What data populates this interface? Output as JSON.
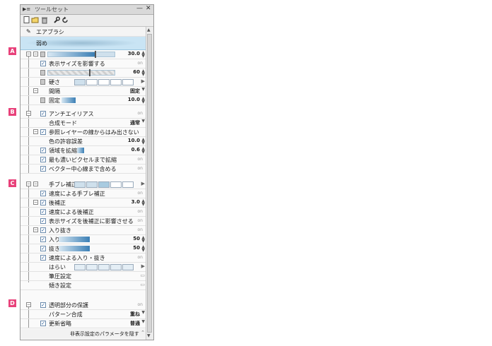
{
  "markers": [
    "A",
    "B",
    "C",
    "D"
  ],
  "titlebar": {
    "tab_label": "ツールセット",
    "minimize": "—",
    "close": "✕"
  },
  "toolbar_icons": [
    "new-sub-tool-icon",
    "folder-icon",
    "trash-icon",
    "wrench-icon",
    "reset-icon"
  ],
  "header": {
    "tool_name": "エアブラシ",
    "subtool": "弱め"
  },
  "rows": {
    "brush_size": {
      "value": "30.0",
      "fill_percent": 70
    },
    "size_pressure": {
      "label": "表示サイズを影響する",
      "state": "on"
    },
    "density": {
      "value": "60",
      "fill_percent": 60
    },
    "hardness": {
      "label": "硬さ",
      "cells": 5
    },
    "spacing": {
      "label": "間隔",
      "value": "固定"
    },
    "fixed": {
      "label": "固定",
      "value": "10.0",
      "fill_percent": 20
    },
    "antialias": {
      "label": "アンチエイリアス",
      "state": "on"
    },
    "blend_mode": {
      "label": "合成モード",
      "value": "通常"
    },
    "ref_layer": {
      "label": "参照レイヤーの線からはみ出さない",
      "state": "on"
    },
    "color_tolerance": {
      "label": "色の許容誤差",
      "value": "10.0"
    },
    "area_scale": {
      "label": "領域を拡縮",
      "value": "0.6",
      "fill_percent": 10
    },
    "expand_dark": {
      "label": "最も濃いピクセルまで拡縮",
      "state": "on"
    },
    "vector_center": {
      "label": "ベクター中心線まで含める",
      "state": "on"
    },
    "stabilize": {
      "label": "手ブレ補正",
      "cells": 5
    },
    "speed_stabilize": {
      "label": "速度による手ブレ補正",
      "state": "on"
    },
    "post_correct": {
      "label": "後補正",
      "value": "3.0"
    },
    "speed_post": {
      "label": "速度による後補正",
      "state": "on"
    },
    "size_post": {
      "label": "表示サイズを後補正に影響させる",
      "state": "on"
    },
    "taper": {
      "label": "入り抜き",
      "state": "on"
    },
    "taper_in": {
      "label": "入り",
      "value": "50",
      "fill_percent": 40
    },
    "taper_out": {
      "label": "抜き",
      "value": "50",
      "fill_percent": 40
    },
    "speed_taper": {
      "label": "速度による入り・抜き",
      "state": "on"
    },
    "harai": {
      "label": "はらい",
      "cells": 5
    },
    "pen_pressure": {
      "label": "筆圧設定"
    },
    "tilt": {
      "label": "傾き設定"
    },
    "protect_alpha": {
      "label": "透明部分の保護",
      "state": "on"
    },
    "pattern_blend": {
      "label": "パターン合成",
      "value": "重ね"
    },
    "update_skip": {
      "label": "更新省略",
      "value": "普通"
    }
  },
  "footer": {
    "label": "非表示設定のパラメータを隠す"
  }
}
